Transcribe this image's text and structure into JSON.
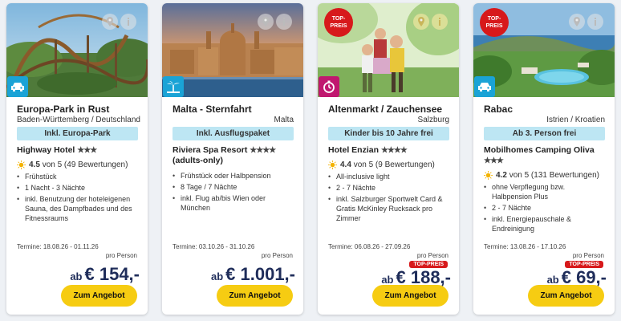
{
  "colors": {
    "accent": "#f6cc12",
    "badge_red": "#d7191b",
    "package_bg": "#bde6f3",
    "price_text": "#1f2d5a",
    "tag_blue": "#1aa3d6",
    "tag_magenta": "#c0186f"
  },
  "cards": [
    {
      "title": "Europa-Park in Rust",
      "region": "Baden-Württemberg / Deutschland",
      "package": "Inkl. Europa-Park",
      "hotel": "Highway Hotel",
      "stars": "★★★",
      "rating_value": "4.5",
      "rating_text": "von 5 (49 Bewertungen)",
      "features": [
        "Frühstück",
        "1 Nacht - 3 Nächte",
        "inkl. Benutzung der hoteleigenen Sauna, des Dampfbades und des Fitnessraums"
      ],
      "termine": "Termine: 18.08.26 - 01.11.26",
      "pro_person": "pro Person",
      "price_prefix": "ab",
      "price": "€ 154,-",
      "button": "Zum Angebot",
      "category_icon": "car-icon"
    },
    {
      "title": "Malta - Sternfahrt",
      "region": "Malta",
      "package": "Inkl. Ausflugspaket",
      "hotel": "Riviera Spa Resort",
      "stars": "★★★★",
      "hotel_sub": "(adults-only)",
      "features": [
        "Frühstück oder Halbpension",
        "8 Tage / 7 Nächte",
        "inkl. Flug ab/bis Wien oder München"
      ],
      "termine": "Termine: 03.10.26 - 31.10.26",
      "pro_person": "pro Person",
      "price_prefix": "ab",
      "price": "€ 1.001,-",
      "button": "Zum Angebot",
      "category_icon": "palm-beach-icon"
    },
    {
      "title": "Altenmarkt / Zauchensee",
      "region": "Salzburg",
      "package": "Kinder bis 10 Jahre frei",
      "hotel": "Hotel Enzian",
      "stars": "★★★★",
      "rating_value": "4.4",
      "rating_text": "von 5 (9 Bewertungen)",
      "features": [
        "All-inclusive light",
        "2 - 7 Nächte",
        "inkl. Salzburger Sportwelt Card & Gratis McKinley Rucksack pro Zimmer"
      ],
      "termine": "Termine: 06.08.26 - 27.09.26",
      "pro_person": "pro Person",
      "price_badge": "TOP-PREIS",
      "price_prefix": "ab",
      "price": "€ 188,-",
      "button": "Zum Angebot",
      "image_badge_line1": "TOP-",
      "image_badge_line2": "PREIS",
      "category_icon": "stopwatch-icon"
    },
    {
      "title": "Rabac",
      "region": "Istrien / Kroatien",
      "package": "Ab 3. Person frei",
      "hotel": "Mobilhomes Camping Oliva",
      "stars": "★★★",
      "rating_value": "4.2",
      "rating_text": "von 5 (131 Bewertungen)",
      "features": [
        "ohne Verpflegung bzw. Halbpension Plus",
        "2 - 7 Nächte",
        "inkl. Energiepauschale & Endreinigung"
      ],
      "termine": "Termine: 13.08.26 - 17.10.26",
      "pro_person": "pro Person",
      "price_badge": "TOP-PREIS",
      "price_prefix": "ab",
      "price": "€ 69,-",
      "button": "Zum Angebot",
      "image_badge_line1": "TOP-",
      "image_badge_line2": "PREIS",
      "category_icon": "car-icon"
    }
  ]
}
